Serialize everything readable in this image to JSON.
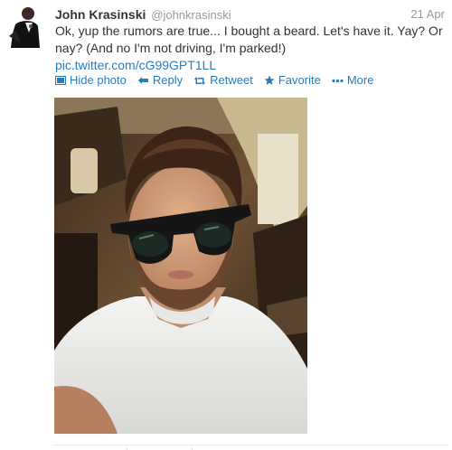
{
  "tweet": {
    "author_name": "John Krasinski",
    "screen_name": "@johnkrasinski",
    "timestamp": "21 Apr",
    "text": "Ok, yup the rumors are true... I bought a beard. Let's have it. Yay? Or nay? (And no I'm not driving, I'm parked!)",
    "link": "pic.twitter.com/cG99GPT1LL"
  },
  "actions": {
    "hide_photo": "Hide photo",
    "reply": "Reply",
    "retweet": "Retweet",
    "favorite": "Favorite",
    "more": "More"
  },
  "icons": {
    "avatar": "profile-avatar",
    "hide_photo": "photo-icon",
    "reply": "reply-arrow-icon",
    "retweet": "retweet-icon",
    "favorite": "star-icon",
    "more": "ellipsis-icon"
  },
  "colors": {
    "text": "#333333",
    "muted": "#999999",
    "link": "#2b7bb9"
  }
}
